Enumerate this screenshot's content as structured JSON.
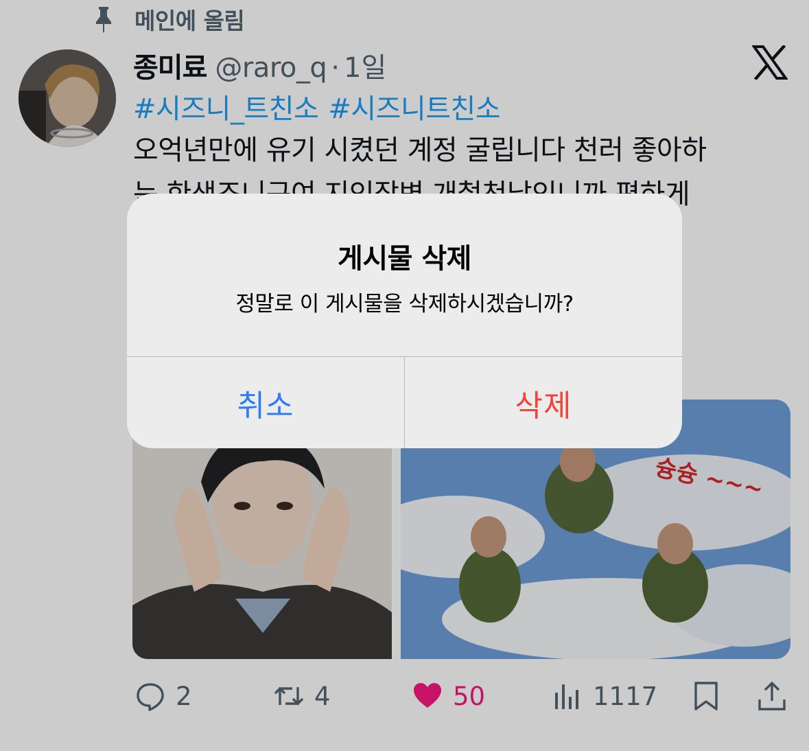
{
  "pinned": {
    "label": "메인에 올림",
    "icon": "pin-icon"
  },
  "tweet": {
    "display_name": "종미료",
    "handle": "@raro_q",
    "separator": "·",
    "time": "1일",
    "hashtags": [
      "#시즈니_트친소",
      "#시즈니트친소"
    ],
    "text_lines": [
      "오억년만에 유기 시켰던 계정 굴립니다 천러 좋아하",
      "는 한생조니구여 지인잡변 개철천남인니까 편하게"
    ]
  },
  "actions": {
    "replies": "2",
    "retweets": "4",
    "likes": "50",
    "views": "1117"
  },
  "dialog": {
    "title": "게시물 삭제",
    "message": "정말로 이 게시물을 삭제하시겠습니까?",
    "cancel_label": "취소",
    "delete_label": "삭제"
  },
  "media": {
    "right_caption": "슝슝 ~~~"
  },
  "colors": {
    "link": "#1d9bf0",
    "like": "#f91880",
    "cancel": "#2f7bf6",
    "destructive": "#f0453b",
    "secondary_text": "#536471"
  }
}
